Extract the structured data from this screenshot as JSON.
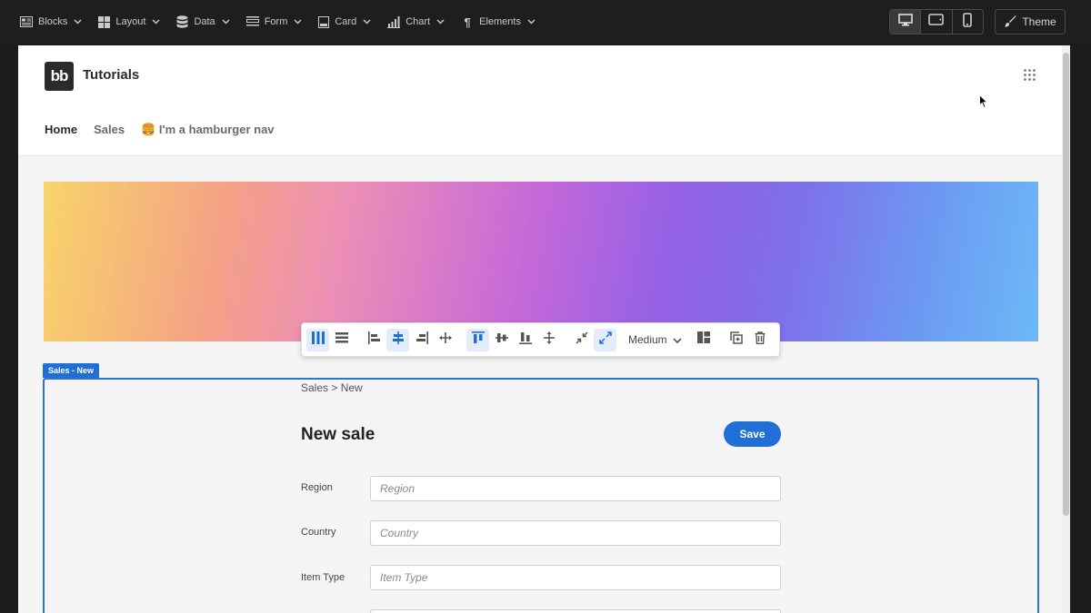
{
  "builder": {
    "menu": [
      {
        "label": "Blocks",
        "icon": "blocks-icon"
      },
      {
        "label": "Layout",
        "icon": "layout-icon"
      },
      {
        "label": "Data",
        "icon": "database-icon"
      },
      {
        "label": "Form",
        "icon": "form-icon"
      },
      {
        "label": "Card",
        "icon": "card-icon"
      },
      {
        "label": "Chart",
        "icon": "chart-icon"
      },
      {
        "label": "Elements",
        "icon": "paragraph-icon"
      }
    ],
    "devices": [
      "desktop",
      "tablet",
      "mobile"
    ],
    "active_device": "desktop",
    "theme_label": "Theme"
  },
  "app": {
    "logo_text": "bb",
    "title": "Tutorials",
    "nav": [
      {
        "label": "Home",
        "active": true
      },
      {
        "label": "Sales",
        "active": false
      },
      {
        "label": "🍔 I'm a hamburger nav",
        "active": false
      }
    ]
  },
  "toolbar": {
    "size_label": "Medium",
    "active_buttons": [
      "columns",
      "align-center",
      "valign-top",
      "expand"
    ]
  },
  "component": {
    "tag": "Sales - New",
    "breadcrumb": "Sales > New",
    "title": "New sale",
    "save_label": "Save",
    "fields": [
      {
        "label": "Region",
        "placeholder": "Region"
      },
      {
        "label": "Country",
        "placeholder": "Country"
      },
      {
        "label": "Item Type",
        "placeholder": "Item Type"
      }
    ]
  },
  "colors": {
    "accent": "#1f6fd6",
    "topbar": "#1e1e1e"
  }
}
